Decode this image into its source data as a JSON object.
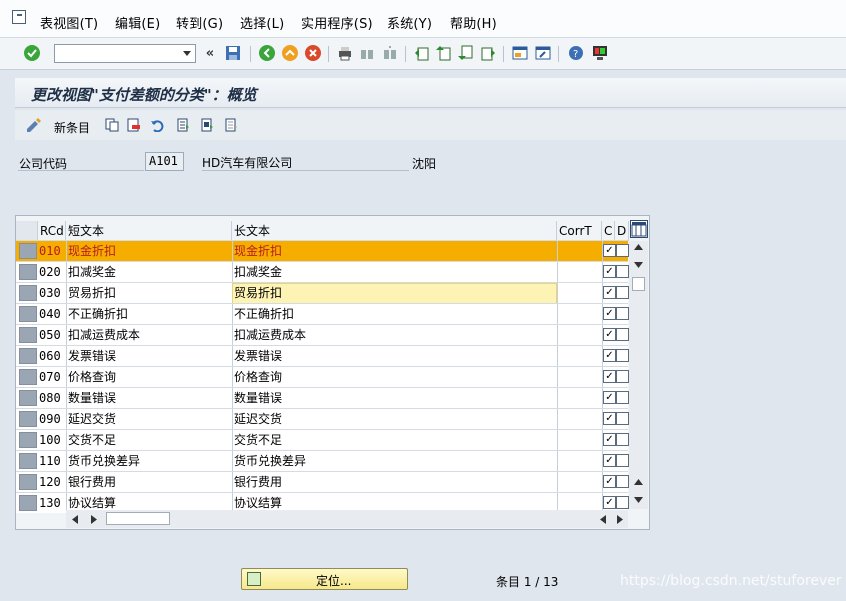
{
  "menu": [
    "表视图(T)",
    "编辑(E)",
    "转到(G)",
    "选择(L)",
    "实用程序(S)",
    "系统(Y)",
    "帮助(H)"
  ],
  "toolbar": {
    "command_value": ""
  },
  "title": "更改视图\"支付差额的分类\"：概览",
  "app_toolbar": {
    "new_entries": "新条目"
  },
  "company": {
    "label": "公司代码",
    "code": "A101",
    "name": "HD汽车有限公司",
    "city": "沈阳"
  },
  "table": {
    "headers": [
      "RCd",
      "短文本",
      "长文本",
      "CorrT",
      "C",
      "D"
    ],
    "rows": [
      {
        "code": "010",
        "short": "现金折扣",
        "long": "现金折扣"
      },
      {
        "code": "020",
        "short": "扣减奖金",
        "long": "扣减奖金"
      },
      {
        "code": "030",
        "short": "贸易折扣",
        "long": "贸易折扣"
      },
      {
        "code": "040",
        "short": "不正确折扣",
        "long": "不正确折扣"
      },
      {
        "code": "050",
        "short": "扣减运费成本",
        "long": "扣减运费成本"
      },
      {
        "code": "060",
        "short": "发票错误",
        "long": "发票错误"
      },
      {
        "code": "070",
        "short": "价格查询",
        "long": "价格查询"
      },
      {
        "code": "080",
        "short": "数量错误",
        "long": "数量错误"
      },
      {
        "code": "090",
        "short": "延迟交货",
        "long": "延迟交货"
      },
      {
        "code": "100",
        "short": "交货不足",
        "long": "交货不足"
      },
      {
        "code": "110",
        "short": "货币兑换差异",
        "long": "货币兑换差异"
      },
      {
        "code": "120",
        "short": "银行费用",
        "long": "银行费用"
      },
      {
        "code": "130",
        "short": "协议结算",
        "long": "协议结算"
      }
    ]
  },
  "footer": {
    "locate_label": "定位...",
    "entries": "条目 1 / 13"
  },
  "watermark": "https://blog.csdn.net/stuforever",
  "colors": {
    "selected_row": "#f5ad00",
    "selected_text": "#b71c1c",
    "button_yellow": "#f6e88a"
  }
}
